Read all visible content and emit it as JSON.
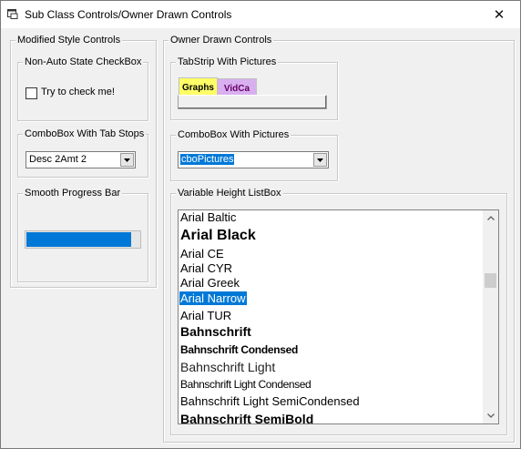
{
  "window": {
    "title": "Sub Class Controls/Owner Drawn Controls",
    "close_glyph": "✕"
  },
  "modified_style": {
    "legend": "Modified Style Controls",
    "checkbox_group": {
      "legend": "Non-Auto State CheckBox",
      "label": "Try to check me!",
      "checked": false
    },
    "combo_group": {
      "legend": "ComboBox With Tab Stops",
      "value": "Desc 2Amt 2"
    },
    "progress_group": {
      "legend": "Smooth Progress Bar",
      "progress": 0.93
    }
  },
  "owner_drawn": {
    "legend": "Owner Drawn Controls",
    "tabstrip_group": {
      "legend": "TabStrip With Pictures",
      "tabs": [
        "Graphs",
        "VidCa"
      ]
    },
    "combo_pictures_group": {
      "legend": "ComboBox With Pictures",
      "value": "cboPictures"
    },
    "listbox_group": {
      "legend": "Variable Height ListBox",
      "items": [
        "Arial Baltic",
        "Arial Black",
        "Arial CE",
        "Arial CYR",
        "Arial Greek",
        "Arial Narrow",
        "Arial TUR",
        "Bahnschrift",
        "Bahnschrift Condensed",
        "Bahnschrift Light",
        "Bahnschrift Light Condensed",
        "Bahnschrift Light SemiCondensed",
        "Bahnschrift SemiBold"
      ],
      "selected_item": "Arial Narrow"
    }
  },
  "colors": {
    "selection": "#0078d7",
    "progress": "#0078d7"
  }
}
